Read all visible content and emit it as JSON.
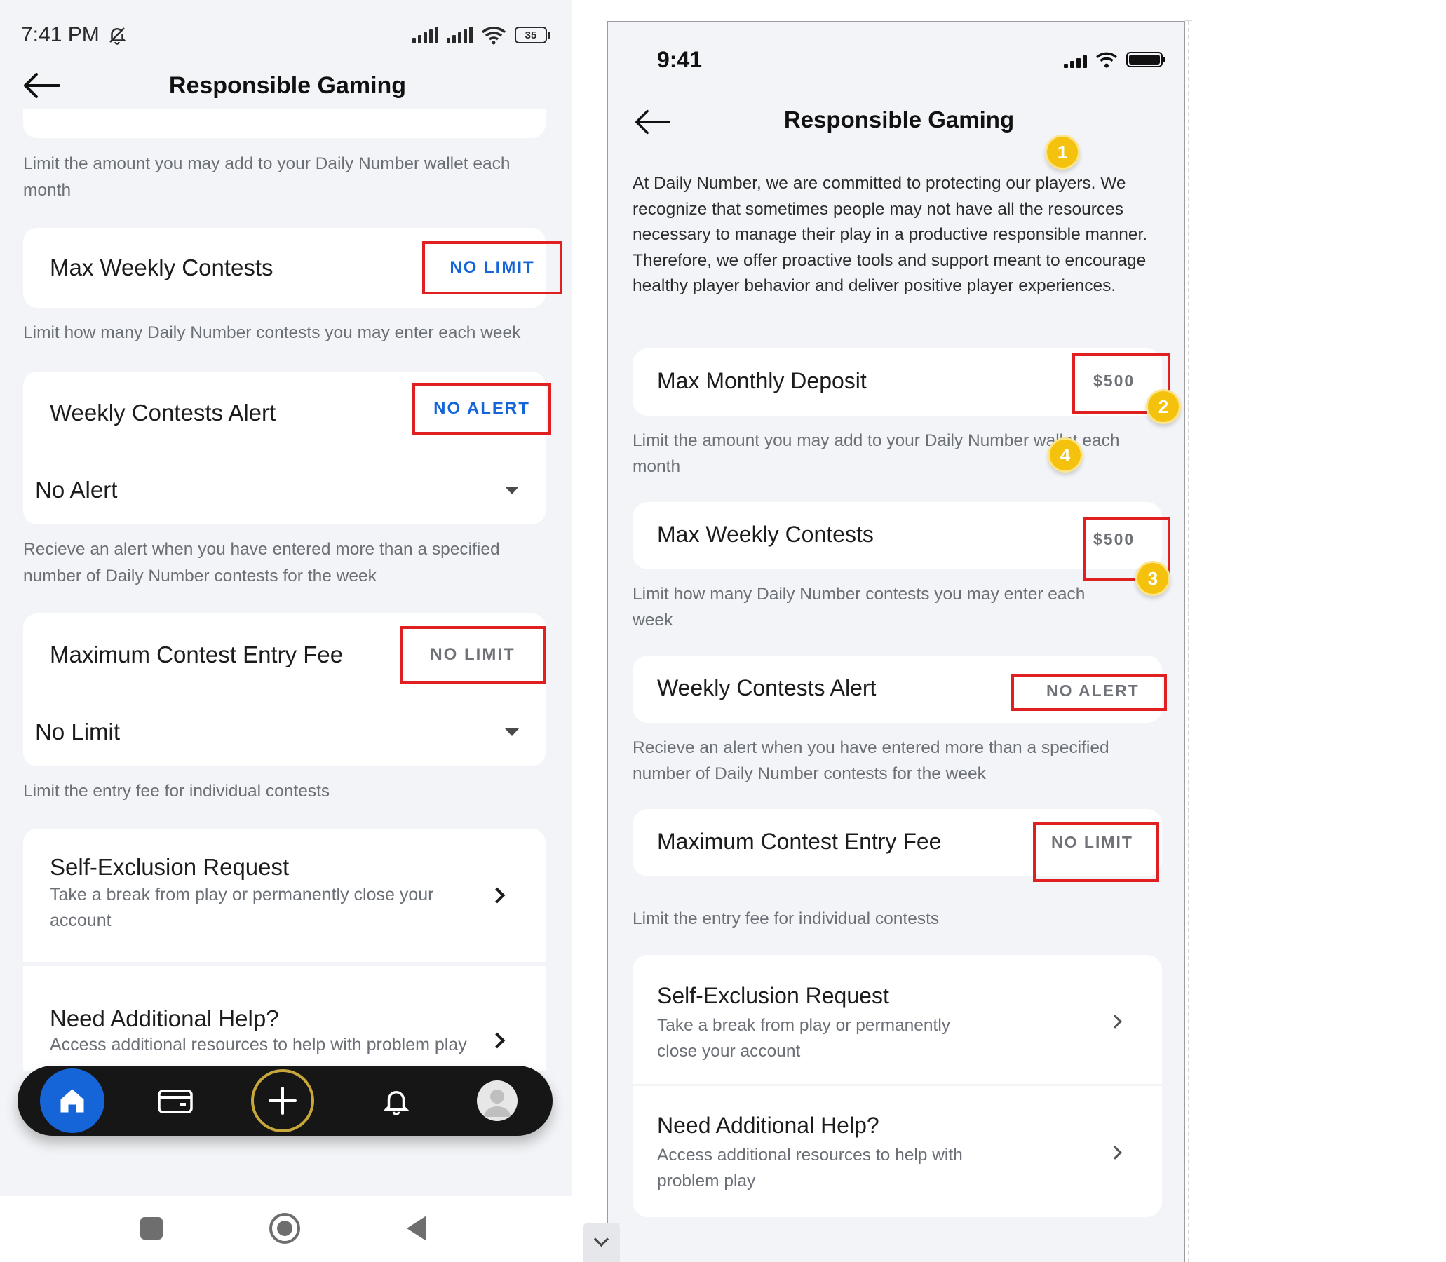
{
  "left_phone": {
    "status": {
      "time": "7:41 PM",
      "battery": "35"
    },
    "header": {
      "title": "Responsible Gaming"
    },
    "deposit_helper": "Limit the amount you may add to your Daily Number wallet each month",
    "max_weekly_contests": {
      "label": "Max Weekly Contests",
      "value": "NO LIMIT",
      "helper": "Limit how many Daily Number contests you may enter each week"
    },
    "weekly_contests_alert": {
      "label": "Weekly Contests Alert",
      "value": "NO ALERT",
      "selected": "No Alert",
      "helper": "Recieve an alert when you have entered more than a specified number of Daily Number contests for the week"
    },
    "max_entry_fee": {
      "label": "Maximum Contest Entry Fee",
      "value": "NO LIMIT",
      "selected": "No Limit",
      "helper": "Limit the entry fee for individual contests"
    },
    "self_exclusion": {
      "title": "Self-Exclusion Request",
      "subtitle": "Take a break from play or permanently close your account"
    },
    "additional_help": {
      "title": "Need Additional Help?",
      "subtitle": "Access additional resources to help with problem play"
    },
    "tab_icons": [
      "home-icon",
      "wallet-icon",
      "plus-icon",
      "bell-icon",
      "profile-icon"
    ],
    "system_nav_icons": [
      "recents-icon",
      "home-circle-icon",
      "back-triangle-icon"
    ]
  },
  "right_phone": {
    "status": {
      "time": "9:41"
    },
    "header": {
      "title": "Responsible Gaming"
    },
    "intro": "At Daily Number, we are committed to protecting our players. We recognize that sometimes people may not have all the resources necessary to manage their play in a productive responsible manner. Therefore, we offer proactive tools and support meant to encourage healthy player behavior and deliver positive player experiences.",
    "rows": [
      {
        "label": "Max Monthly Deposit",
        "value": "$500",
        "helper": "Limit the amount you may add to your Daily Number wallet each month"
      },
      {
        "label": "Max Weekly Contests",
        "value": "$500",
        "helper": "Limit how many Daily Number contests you may enter each week"
      },
      {
        "label": "Weekly Contests Alert",
        "value": "NO ALERT",
        "helper": "Recieve an alert when you have entered more than a specified number of Daily Number contests for the week"
      },
      {
        "label": "Maximum Contest Entry Fee",
        "value": "NO LIMIT",
        "helper": "Limit the entry fee for individual contests"
      }
    ],
    "links": [
      {
        "title": "Self-Exclusion Request",
        "subtitle": "Take a break from play or permanently close your account"
      },
      {
        "title": "Need Additional Help?",
        "subtitle": "Access additional resources to help with problem play"
      }
    ],
    "badges": [
      "1",
      "2",
      "3",
      "4"
    ]
  },
  "colors": {
    "accent_blue": "#1565d8",
    "annotation_red": "#e02020",
    "badge_yellow": "#f4c20d",
    "background": "#f2f4f7"
  }
}
